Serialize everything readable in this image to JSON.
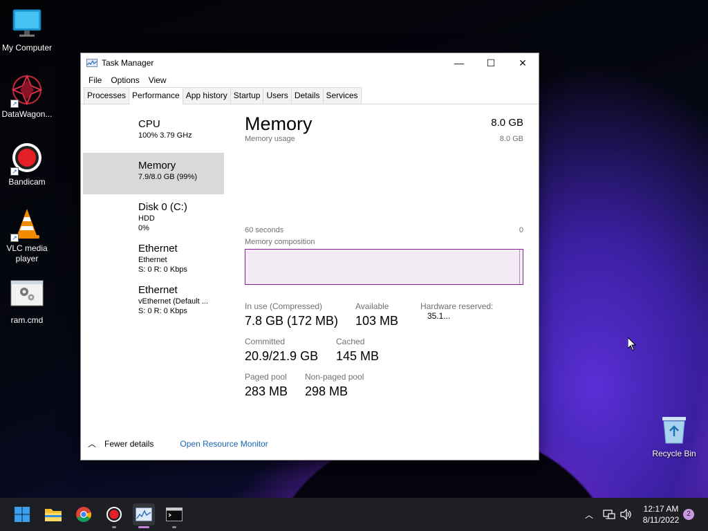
{
  "desktop": {
    "icons": [
      {
        "label": "My Computer",
        "icon": "monitor-icon",
        "shortcut": false
      },
      {
        "label": "DataWagon...",
        "icon": "datawagon-icon",
        "shortcut": true
      },
      {
        "label": "Bandicam",
        "icon": "bandicam-icon",
        "shortcut": true
      },
      {
        "label": "VLC media player",
        "icon": "vlc-icon",
        "shortcut": true
      },
      {
        "label": "ram.cmd",
        "icon": "cmd-file-icon",
        "shortcut": false
      },
      {
        "label": "Recycle Bin",
        "icon": "recycle-bin-icon",
        "shortcut": false
      }
    ]
  },
  "window": {
    "title": "Task Manager",
    "controls": {
      "minimize": "—",
      "maximize": "☐",
      "close": "✕"
    },
    "menu": [
      "File",
      "Options",
      "View"
    ],
    "tabs": [
      "Processes",
      "Performance",
      "App history",
      "Startup",
      "Users",
      "Details",
      "Services"
    ],
    "active_tab": "Performance"
  },
  "sidebar": {
    "items": [
      {
        "name": "CPU",
        "line1": "100%  3.79 GHz",
        "line2": "",
        "active": false
      },
      {
        "name": "Memory",
        "line1": "7.9/8.0 GB (99%)",
        "line2": "",
        "active": true
      },
      {
        "name": "Disk 0 (C:)",
        "line1": "HDD",
        "line2": "0%",
        "active": false
      },
      {
        "name": "Ethernet",
        "line1": "Ethernet",
        "line2": "S: 0  R: 0 Kbps",
        "active": false
      },
      {
        "name": "Ethernet",
        "line1": "vEthernet (Default ...",
        "line2": "S: 0  R: 0 Kbps",
        "active": false
      }
    ]
  },
  "memory": {
    "title": "Memory",
    "total": "8.0 GB",
    "usage_label": "Memory usage",
    "usage_max": "8.0 GB",
    "time_label": "60 seconds",
    "time_zero": "0",
    "composition_label": "Memory composition",
    "stats": {
      "in_use_label": "In use (Compressed)",
      "in_use_value": "7.8 GB (172 MB)",
      "available_label": "Available",
      "available_value": "103 MB",
      "hw_reserved_label": "Hardware reserved:",
      "hw_reserved_value": "35.1...",
      "committed_label": "Committed",
      "committed_value": "20.9/21.9 GB",
      "cached_label": "Cached",
      "cached_value": "145 MB",
      "paged_label": "Paged pool",
      "paged_value": "283 MB",
      "nonpaged_label": "Non-paged pool",
      "nonpaged_value": "298 MB"
    }
  },
  "footer": {
    "fewer_details": "Fewer details",
    "resource_monitor": "Open Resource Monitor"
  },
  "taskbar": {
    "apps": [
      "start-icon",
      "file-explorer-icon",
      "chrome-icon",
      "bandicam-icon",
      "task-manager-icon",
      "terminal-icon"
    ],
    "active_app": "task-manager-icon",
    "time": "12:17 AM",
    "date": "8/11/2022",
    "notifications": "2"
  },
  "colors": {
    "accent_memory": "#8b1f9b",
    "link": "#1a64b4",
    "selected": "#d9d9d9"
  }
}
